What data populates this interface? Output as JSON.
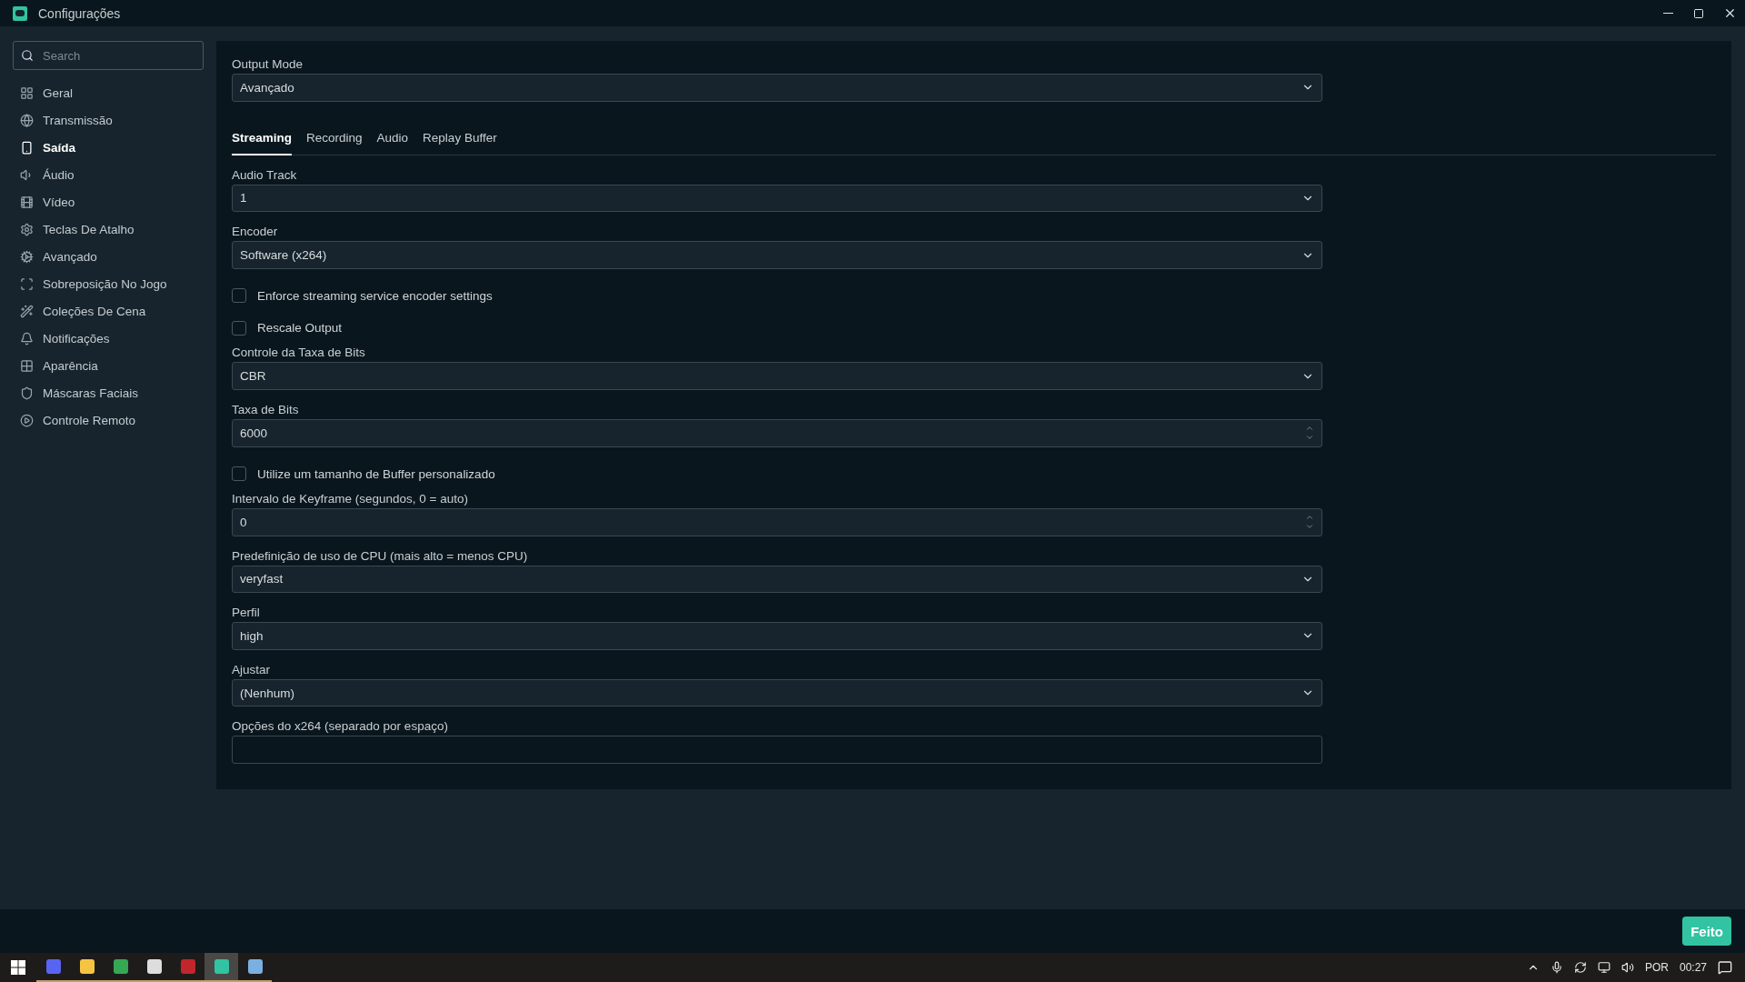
{
  "window": {
    "title": "Configurações"
  },
  "sidebar": {
    "search": {
      "placeholder": "Search"
    },
    "items": [
      {
        "label": "Geral",
        "selected": false
      },
      {
        "label": "Transmissão",
        "selected": false
      },
      {
        "label": "Saída",
        "selected": true
      },
      {
        "label": "Áudio",
        "selected": false
      },
      {
        "label": "Vídeo",
        "selected": false
      },
      {
        "label": "Teclas De Atalho",
        "selected": false
      },
      {
        "label": "Avançado",
        "selected": false
      },
      {
        "label": "Sobreposição No Jogo",
        "selected": false
      },
      {
        "label": "Coleções De Cena",
        "selected": false
      },
      {
        "label": "Notificações",
        "selected": false
      },
      {
        "label": "Aparência",
        "selected": false
      },
      {
        "label": "Máscaras Faciais",
        "selected": false
      },
      {
        "label": "Controle Remoto",
        "selected": false
      }
    ]
  },
  "output_mode": {
    "label": "Output Mode",
    "value": "Avançado"
  },
  "tabs": [
    {
      "label": "Streaming",
      "selected": true
    },
    {
      "label": "Recording",
      "selected": false
    },
    {
      "label": "Audio",
      "selected": false
    },
    {
      "label": "Replay Buffer",
      "selected": false
    }
  ],
  "fields": [
    {
      "kind": "select",
      "label": "Audio Track",
      "value": "1"
    },
    {
      "kind": "select",
      "label": "Encoder",
      "value": "Software (x264)"
    },
    {
      "kind": "checkbox",
      "label": "Enforce streaming service encoder settings",
      "checked": false
    },
    {
      "kind": "checkbox",
      "label": "Rescale Output",
      "checked": false
    },
    {
      "kind": "select",
      "label": "Controle da Taxa de Bits",
      "value": "CBR"
    },
    {
      "kind": "number",
      "label": "Taxa de Bits",
      "value": "6000"
    },
    {
      "kind": "checkbox",
      "label": "Utilize um tamanho de Buffer personalizado",
      "checked": false
    },
    {
      "kind": "number",
      "label": "Intervalo de Keyframe (segundos, 0 = auto)",
      "value": "0"
    },
    {
      "kind": "select",
      "label": "Predefinição de uso de CPU (mais alto = menos CPU)",
      "value": "veryfast"
    },
    {
      "kind": "select",
      "label": "Perfil",
      "value": "high"
    },
    {
      "kind": "select",
      "label": "Ajustar",
      "value": "(Nenhum)"
    },
    {
      "kind": "text",
      "label": "Opções do x264 (separado por espaço)"
    }
  ],
  "done_button": "Feito",
  "taskbar": {
    "apps": [
      {
        "selected": false
      },
      {
        "selected": false
      },
      {
        "selected": false
      },
      {
        "selected": false
      },
      {
        "selected": false
      },
      {
        "selected": true
      },
      {
        "selected": false
      }
    ],
    "language": "POR",
    "time": "00:27"
  }
}
